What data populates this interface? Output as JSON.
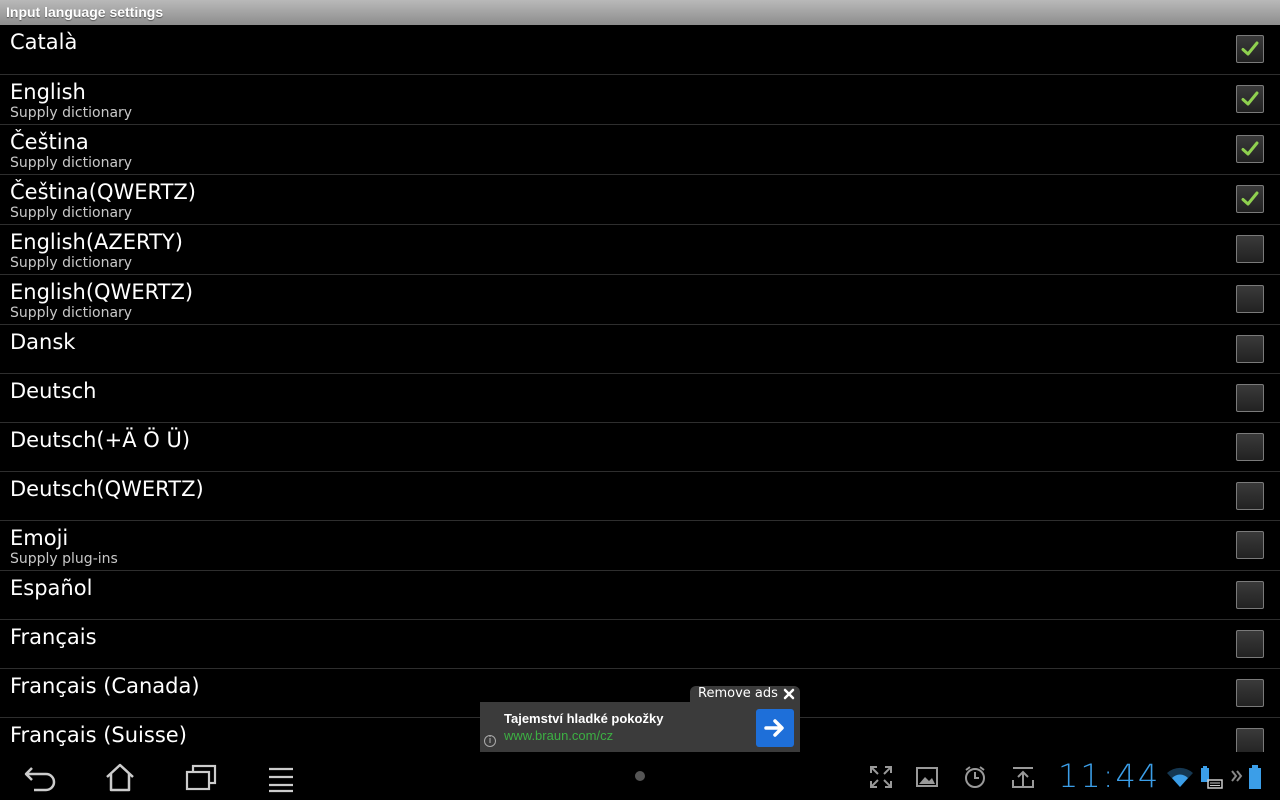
{
  "title": "Input language settings",
  "languages": [
    {
      "name": "Català",
      "sub": "",
      "checked": true
    },
    {
      "name": "English",
      "sub": "Supply dictionary",
      "checked": true
    },
    {
      "name": "Čeština",
      "sub": "Supply dictionary",
      "checked": true
    },
    {
      "name": "Čeština(QWERTZ)",
      "sub": "Supply dictionary",
      "checked": true
    },
    {
      "name": "English(AZERTY)",
      "sub": "Supply dictionary",
      "checked": false
    },
    {
      "name": "English(QWERTZ)",
      "sub": "Supply dictionary",
      "checked": false
    },
    {
      "name": "Dansk",
      "sub": "",
      "checked": false
    },
    {
      "name": "Deutsch",
      "sub": "",
      "checked": false
    },
    {
      "name": "Deutsch(+Ä Ö Ü)",
      "sub": "",
      "checked": false
    },
    {
      "name": "Deutsch(QWERTZ)",
      "sub": "",
      "checked": false
    },
    {
      "name": "Emoji",
      "sub": "Supply plug-ins",
      "checked": false
    },
    {
      "name": "Español",
      "sub": "",
      "checked": false
    },
    {
      "name": "Français",
      "sub": "",
      "checked": false
    },
    {
      "name": "Français (Canada)",
      "sub": "",
      "checked": false
    },
    {
      "name": "Français (Suisse)",
      "sub": "",
      "checked": false
    }
  ],
  "ad": {
    "remove_label": "Remove ads",
    "title": "Tajemství hladké pokožky",
    "url": "www.braun.com/cz",
    "info_glyph": "i"
  },
  "statusbar": {
    "time": "11:44"
  },
  "colors": {
    "check": "#8fd14f",
    "clock": "#3b9ee8",
    "ad_url": "#3cb043"
  }
}
